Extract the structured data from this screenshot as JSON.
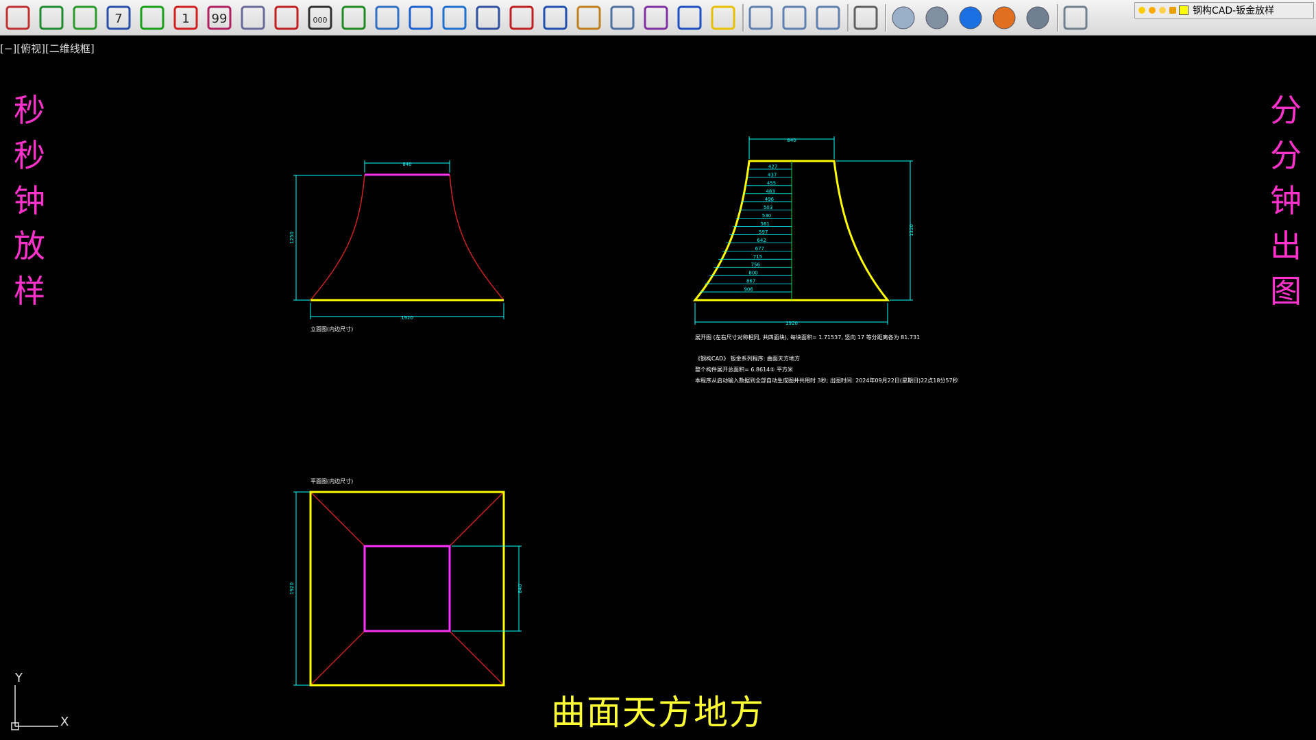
{
  "toolbar": {
    "buttons": [
      {
        "name": "settings-gear-icon"
      },
      {
        "name": "rectangle-frame-icon"
      },
      {
        "name": "checkmark-icon"
      },
      {
        "name": "calendar-7-icon",
        "label": "7"
      },
      {
        "name": "plus-cross-icon"
      },
      {
        "name": "circle-number-1-icon",
        "label": "1"
      },
      {
        "name": "number-99-lines-icon",
        "label": "99"
      },
      {
        "name": "fan-sector-icon"
      },
      {
        "name": "broken-line-icon"
      },
      {
        "name": "dimension-000-icon",
        "label": "000"
      },
      {
        "name": "text-lines-icon"
      },
      {
        "name": "eye-view-icon"
      },
      {
        "name": "scissors-icon"
      },
      {
        "name": "dimension-check-icon"
      },
      {
        "name": "list-check-icon"
      },
      {
        "name": "zoom-plus-icon"
      },
      {
        "name": "pencil-edit-icon"
      },
      {
        "name": "hand-pan-icon"
      },
      {
        "name": "calculator-icon"
      },
      {
        "name": "shape-stop-icon"
      },
      {
        "name": "document-check-icon"
      },
      {
        "name": "smiley-face-icon"
      },
      {
        "name": "orbit-3d-icon"
      },
      {
        "name": "free-orbit-icon"
      },
      {
        "name": "continuous-orbit-icon"
      },
      {
        "name": "region-shape-icon"
      },
      {
        "name": "sphere-wire-icon"
      },
      {
        "name": "sphere-hidden-icon"
      },
      {
        "name": "sphere-blue-icon"
      },
      {
        "name": "sphere-orange-icon"
      },
      {
        "name": "sphere-grid-icon"
      },
      {
        "name": "layers-icon"
      }
    ],
    "layer_name": "钢构CAD-钣金放样"
  },
  "viewport_label": "[−][俯视][二维线框]",
  "left_vertical_text": [
    "秒",
    "秒",
    "钟",
    "放",
    "样"
  ],
  "right_vertical_text": [
    "分",
    "分",
    "钟",
    "出",
    "图"
  ],
  "bottom_title": "曲面天方地方",
  "colors": {
    "background": "#000000",
    "yellow_outline": "#ffff00",
    "magenta_outline": "#ff33ff",
    "red_curve": "#cc2222",
    "dimension_cyan": "#00ffff",
    "overlay_magenta_text": "#ff33cc",
    "overlay_yellow_text": "#ffff33"
  },
  "drawing": {
    "elevation": {
      "label": "立面图(内边尺寸)",
      "top_dim": "840",
      "height_dim": "1250",
      "bottom_dim": "1920"
    },
    "development": {
      "top_dim": "840",
      "height_dim": "1320",
      "bottom_dim": "1920",
      "row_dims": [
        "427",
        "437",
        "455",
        "483",
        "496",
        "503",
        "530",
        "561",
        "597",
        "642",
        "677",
        "715",
        "756",
        "800",
        "867",
        "906"
      ]
    },
    "notes": [
      "展开图 (左右尺寸对称相同, 共四面块), 每块面积= 1.71537, 竖向 17 等分距离各为 81.731",
      "《钢构CAD》 钣金系列程序: 曲面天方地方",
      "整个构件展开总面积= 6.8614⑤ 平方米",
      "本程序从启动输入数据到全部自动生成图并共用时 3秒; 出图时间: 2024年09月22日(星期日)22点18分57秒"
    ],
    "plan": {
      "label": "平面图(内边尺寸)",
      "left_dim": "1920",
      "right_dim": "840"
    }
  },
  "ucs": {
    "x_label": "X",
    "y_label": "Y"
  }
}
